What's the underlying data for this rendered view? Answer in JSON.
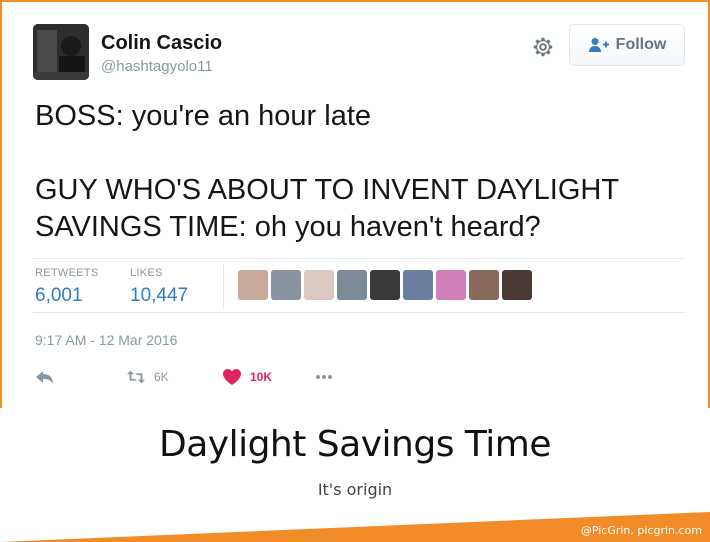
{
  "tweet": {
    "author_name": "Colin Cascio",
    "author_handle": "@hashtagyolo11",
    "follow_label": "Follow",
    "text": "BOSS: you're an hour late\n\nGUY WHO'S ABOUT TO INVENT DAYLIGHT SAVINGS TIME: oh you haven't heard?",
    "stats": {
      "retweets_label": "RETWEETS",
      "retweets_value": "6,001",
      "likes_label": "LIKES",
      "likes_value": "10,447"
    },
    "likers": [
      {
        "color": "#c8a89a"
      },
      {
        "color": "#8a94a0"
      },
      {
        "color": "#d9c9c0"
      },
      {
        "color": "#7d8a99"
      },
      {
        "color": "#3a3a3a"
      },
      {
        "color": "#6a7fa0"
      },
      {
        "color": "#d07fb8"
      },
      {
        "color": "#8a6a5a"
      },
      {
        "color": "#4a3a35"
      }
    ],
    "timestamp": "9:17 AM - 12 Mar 2016",
    "actions": {
      "retweet_count": "6K",
      "like_count": "10K"
    },
    "icons": [
      "gear-icon",
      "follow-person-icon",
      "reply-icon",
      "retweet-icon",
      "heart-icon",
      "more-icon"
    ]
  },
  "caption": {
    "title": "Daylight Savings Time",
    "subtitle": "It's origin"
  },
  "watermark": "@PicGrin, picgrin.com",
  "colors": {
    "frame": "#f28c28",
    "link_blue": "#2f7dc2",
    "muted": "#8899a6",
    "like_red": "#e0245e"
  }
}
